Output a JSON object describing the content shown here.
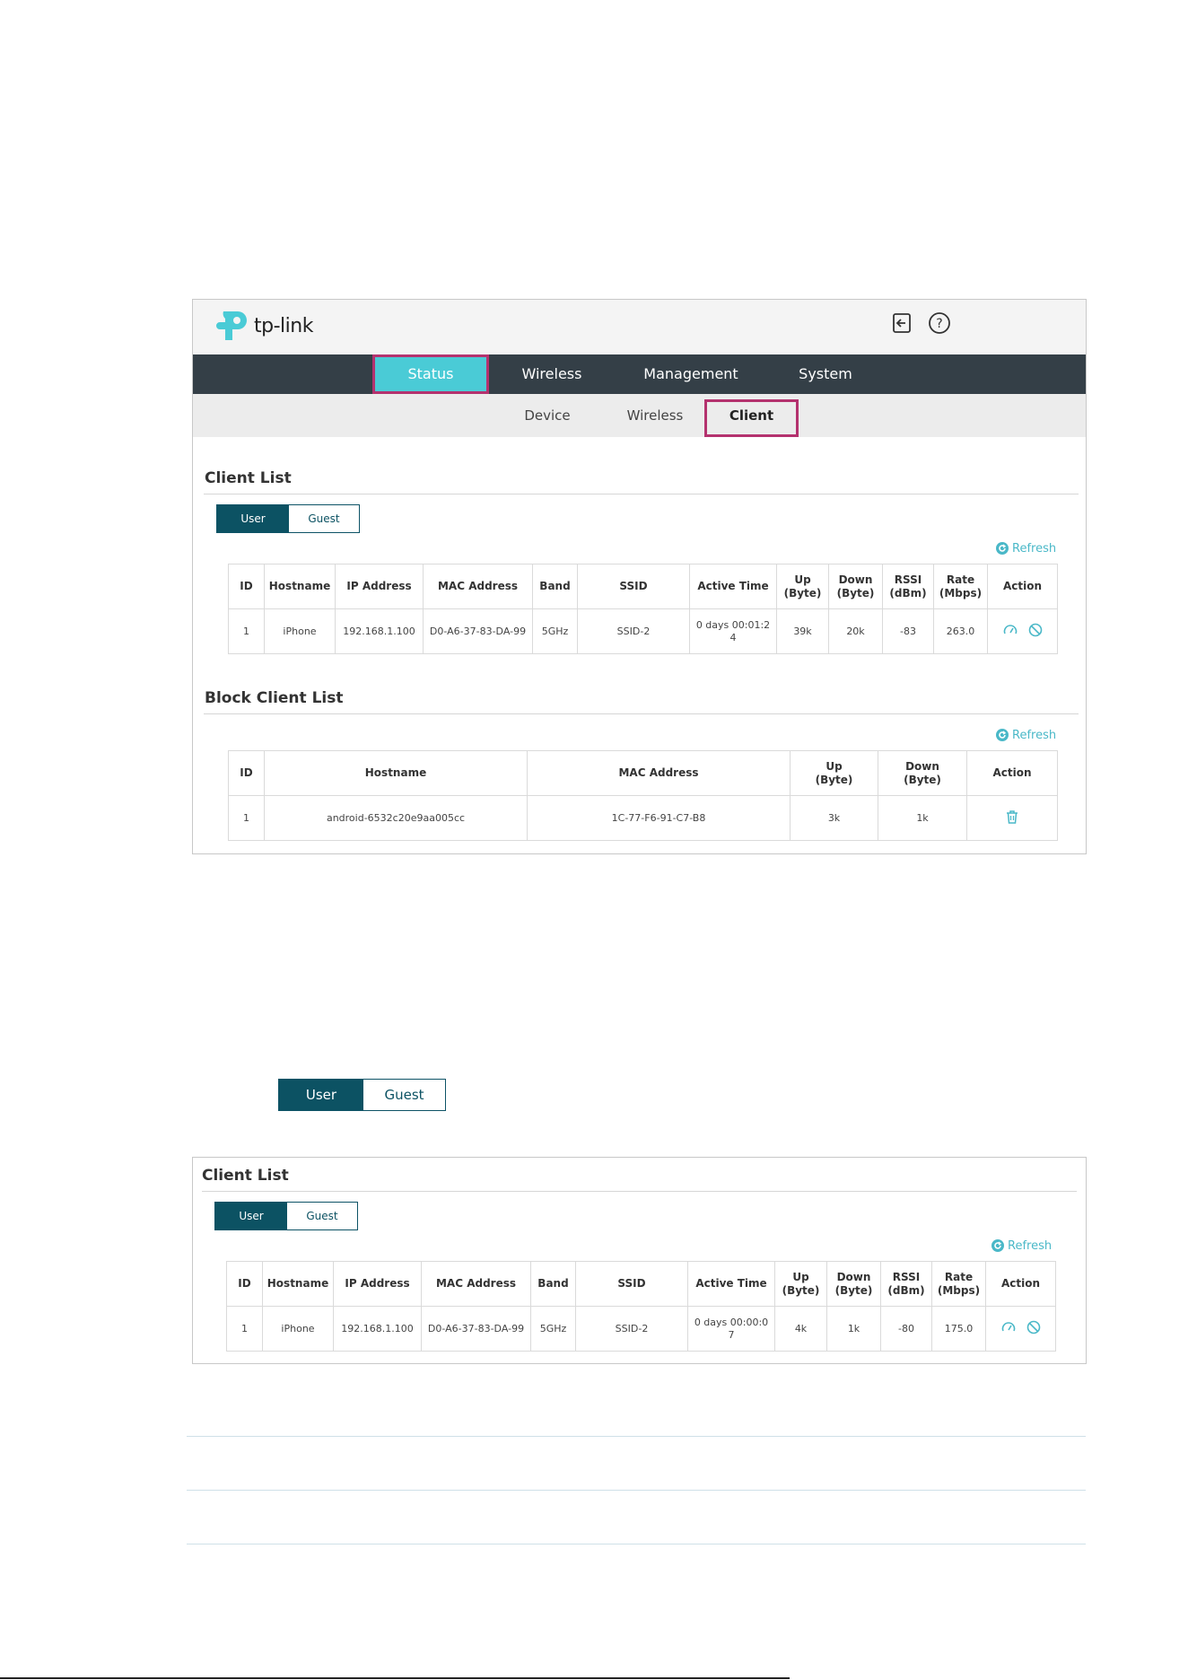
{
  "brand": {
    "logo_text": "tp-link"
  },
  "header": {
    "icons": [
      "logout-icon",
      "help-icon"
    ]
  },
  "nav": {
    "items": [
      {
        "label": "Status",
        "active": true
      },
      {
        "label": "Wireless",
        "active": false
      },
      {
        "label": "Management",
        "active": false
      },
      {
        "label": "System",
        "active": false
      }
    ]
  },
  "subnav": {
    "items": [
      {
        "label": "Device",
        "active": false
      },
      {
        "label": "Wireless",
        "active": false
      },
      {
        "label": "Client",
        "active": true
      }
    ]
  },
  "client_list": {
    "title": "Client List",
    "toggle": {
      "user": "User",
      "guest": "Guest",
      "selected": "User"
    },
    "refresh_label": "Refresh",
    "columns": [
      "ID",
      "Hostname",
      "IP Address",
      "MAC Address",
      "Band",
      "SSID",
      "Active Time",
      "Up (Byte)",
      "Down (Byte)",
      "RSSI (dBm)",
      "Rate (Mbps)",
      "Action"
    ],
    "col_lines": {
      "id": "ID",
      "hostname": "Hostname",
      "ip": "IP Address",
      "mac": "MAC Address",
      "band": "Band",
      "ssid": "SSID",
      "active_time": "Active Time",
      "up_1": "Up",
      "up_2": "(Byte)",
      "down_1": "Down",
      "down_2": "(Byte)",
      "rssi_1": "RSSI",
      "rssi_2": "(dBm)",
      "rate_1": "Rate",
      "rate_2": "(Mbps)",
      "action": "Action"
    },
    "rows": [
      {
        "id": "1",
        "hostname": "iPhone",
        "ip": "192.168.1.100",
        "mac": "D0-A6-37-83-DA-99",
        "band": "5GHz",
        "ssid": "SSID-2",
        "active_time_1": "0 days 00:01:2",
        "active_time_2": "4",
        "up": "39k",
        "down": "20k",
        "rssi": "-83",
        "rate": "263.0",
        "actions": [
          "speed-limit-icon",
          "block-icon"
        ]
      }
    ]
  },
  "block_client_list": {
    "title": "Block Client List",
    "refresh_label": "Refresh",
    "col_lines": {
      "id": "ID",
      "hostname": "Hostname",
      "mac": "MAC Address",
      "up_1": "Up",
      "up_2": "(Byte)",
      "down_1": "Down",
      "down_2": "(Byte)",
      "action": "Action"
    },
    "rows": [
      {
        "id": "1",
        "hostname": "android-6532c20e9aa005cc",
        "mac": "1C-77-F6-91-C7-B8",
        "up": "3k",
        "down": "1k",
        "actions": [
          "delete-icon"
        ]
      }
    ]
  },
  "standalone_toggle": {
    "user": "User",
    "guest": "Guest",
    "selected": "User"
  },
  "client_list_2": {
    "title": "Client List",
    "toggle": {
      "user": "User",
      "guest": "Guest",
      "selected": "User"
    },
    "refresh_label": "Refresh",
    "col_lines": {
      "id": "ID",
      "hostname": "Hostname",
      "ip": "IP Address",
      "mac": "MAC Address",
      "band": "Band",
      "ssid": "SSID",
      "active_time": "Active Time",
      "up_1": "Up",
      "up_2": "(Byte)",
      "down_1": "Down",
      "down_2": "(Byte)",
      "rssi_1": "RSSI",
      "rssi_2": "(dBm)",
      "rate_1": "Rate",
      "rate_2": "(Mbps)",
      "action": "Action"
    },
    "rows": [
      {
        "id": "1",
        "hostname": "iPhone",
        "ip": "192.168.1.100",
        "mac": "D0-A6-37-83-DA-99",
        "band": "5GHz",
        "ssid": "SSID-2",
        "active_time_1": "0 days 00:00:0",
        "active_time_2": "7",
        "up": "4k",
        "down": "1k",
        "rssi": "-80",
        "rate": "175.0",
        "actions": [
          "speed-limit-icon",
          "block-icon"
        ]
      }
    ]
  },
  "colors": {
    "nav_bg": "#343f47",
    "active_tab": "#4acbd6",
    "highlight_border": "#b4326e",
    "toggle_on": "#0c5263",
    "link": "#4ab8c8"
  }
}
